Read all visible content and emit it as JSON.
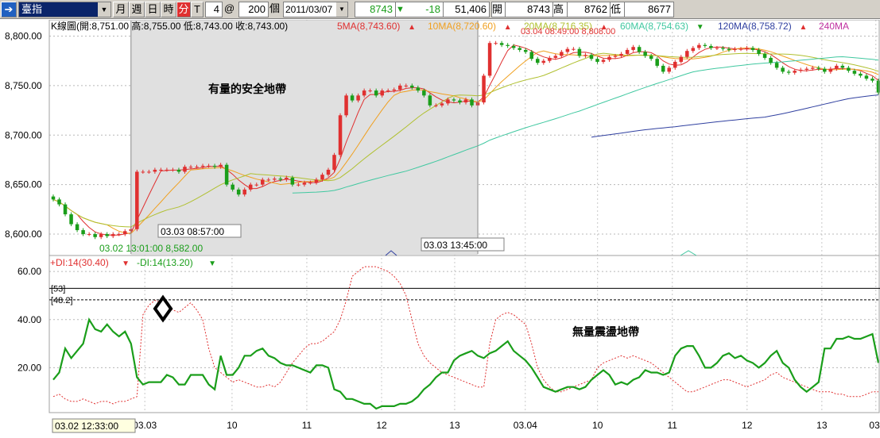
{
  "toolbar": {
    "symbol": "臺指",
    "periods": [
      "月",
      "週",
      "日",
      "時",
      "分",
      "T"
    ],
    "active_period": "分",
    "interval": "4",
    "at": "@",
    "count": "200",
    "count_unit": "個",
    "date": "2011/03/07",
    "quote": {
      "last": "8743",
      "change": "-18",
      "volume": "51,406",
      "open_label": "開",
      "open": "8743",
      "high_label": "高",
      "high": "8762",
      "low_label": "低",
      "low": "8677"
    }
  },
  "colors": {
    "up": "#e03030",
    "down": "#1a9e1a",
    "ma5": "#e03030",
    "ma10": "#f0a020",
    "ma20": "#b0c030",
    "ma60": "#40c8a0",
    "ma120": "#3040a0",
    "ma240": "#c030a0",
    "plus_di": "#e03030",
    "minus_di": "#1a9e1a",
    "highlight": "#e0e0e0"
  },
  "chart_data": [
    {
      "type": "candlestick",
      "title": "K線圖(開:8,751.00 高:8,755.00 低:8,743.00 收:8,743.00)",
      "ma_legend": [
        {
          "name": "5MA",
          "value": "(8,743.60)",
          "dir": "up"
        },
        {
          "name": "10MA",
          "value": "(8,720.60)",
          "dir": "up"
        },
        {
          "name": "20MA",
          "value": "(8,716.35)",
          "dir": "up"
        },
        {
          "name": "60MA",
          "value": "(8,754.63)",
          "dir": "down"
        },
        {
          "name": "120MA",
          "value": "(8,758.72)",
          "dir": "up"
        },
        {
          "name": "240MA",
          "value": "",
          "dir": ""
        }
      ],
      "ylim": [
        8580,
        8810
      ],
      "y_ticks": [
        "8,600.00",
        "8,650.00",
        "8,700.00",
        "8,750.00",
        "8,800.00"
      ],
      "closes": [
        8635,
        8630,
        8620,
        8610,
        8604,
        8600,
        8600,
        8597,
        8600,
        8598,
        8600,
        8600,
        8603,
        8605,
        8663,
        8663,
        8663,
        8665,
        8665,
        8665,
        8665,
        8663,
        8668,
        8668,
        8668,
        8669,
        8669,
        8668,
        8670,
        8650,
        8645,
        8640,
        8645,
        8650,
        8650,
        8655,
        8655,
        8656,
        8655,
        8657,
        8650,
        8650,
        8652,
        8652,
        8655,
        8660,
        8665,
        8680,
        8720,
        8740,
        8735,
        8740,
        8745,
        8745,
        8740,
        8745,
        8745,
        8746,
        8750,
        8750,
        8748,
        8745,
        8740,
        8730,
        8730,
        8732,
        8736,
        8735,
        8733,
        8736,
        8730,
        8733,
        8760,
        8793,
        8793,
        8791,
        8790,
        8788,
        8786,
        8784,
        8777,
        8773,
        8775,
        8778,
        8780,
        8784,
        8787,
        8787,
        8780,
        8781,
        8777,
        8774,
        8776,
        8779,
        8780,
        8782,
        8786,
        8789,
        8784,
        8780,
        8777,
        8770,
        8764,
        8768,
        8774,
        8779,
        8785,
        8788,
        8791,
        8790,
        8788,
        8788,
        8787,
        8786,
        8787,
        8787,
        8788,
        8786,
        8782,
        8778,
        8773,
        8768,
        8764,
        8763,
        8765,
        8766,
        8767,
        8768,
        8767,
        8764,
        8767,
        8770,
        8768,
        8765,
        8762,
        8760,
        8757,
        8755,
        8743
      ],
      "annotations": [
        "有量的安全地帶",
        "03.03 08:57:00",
        "03.03 13:45:00",
        "03.02 13:01:00  8,582.00",
        "03.04 08:49:00  8,808.00"
      ],
      "highlight_range": [
        "03.03 08:57:00",
        "03.03 13:45:00"
      ]
    },
    {
      "type": "line",
      "title": "DMI",
      "series": [
        {
          "name": "+DI:14",
          "value_label": "(30.40)",
          "dir": "down",
          "values": [
            8,
            9,
            7,
            6,
            6,
            7,
            6,
            5,
            6,
            6,
            5,
            6,
            6,
            7,
            8,
            42,
            46,
            48,
            47,
            45,
            44,
            43,
            45,
            47,
            44,
            40,
            28,
            20,
            18,
            16,
            14,
            15,
            14,
            13,
            12,
            12,
            13,
            12,
            14,
            18,
            22,
            25,
            28,
            30,
            30,
            31,
            33,
            35,
            40,
            48,
            58,
            60,
            62,
            62,
            62,
            61,
            60,
            58,
            55,
            50,
            40,
            30,
            25,
            22,
            20,
            18,
            17,
            16,
            15,
            14,
            13,
            12,
            12,
            30,
            40,
            42,
            43,
            42,
            40,
            38,
            30,
            20,
            15,
            12,
            10,
            10,
            11,
            12,
            13,
            14,
            15,
            20,
            22,
            23,
            24,
            25,
            24,
            25,
            24,
            23,
            22,
            20,
            18,
            16,
            14,
            12,
            10,
            10,
            11,
            12,
            13,
            14,
            15,
            15,
            14,
            13,
            12,
            13,
            14,
            15,
            17,
            18,
            16,
            15,
            14,
            13,
            12,
            11,
            10,
            10,
            10,
            9,
            9,
            8,
            8,
            8,
            9,
            10,
            10
          ]
        },
        {
          "name": "-DI:14",
          "value_label": "(13.20)",
          "dir": "down",
          "values": [
            15,
            18,
            28,
            24,
            27,
            30,
            40,
            36,
            35,
            38,
            35,
            33,
            35,
            30,
            16,
            13,
            14,
            14,
            14,
            17,
            16,
            13,
            13,
            17,
            17,
            17,
            13,
            11,
            25,
            17,
            17,
            20,
            25,
            25,
            27,
            28,
            25,
            24,
            22,
            21,
            21,
            20,
            19,
            18,
            21,
            21,
            20,
            11,
            10,
            7,
            7,
            6,
            5,
            5,
            3,
            4,
            4,
            4,
            5,
            5,
            6,
            8,
            11,
            13,
            16,
            18,
            18,
            23,
            25,
            26,
            27,
            25,
            24,
            26,
            27,
            29,
            31,
            27,
            25,
            23,
            20,
            16,
            12,
            11,
            10,
            11,
            12,
            12,
            11,
            12,
            15,
            17,
            19,
            17,
            13,
            14,
            13,
            15,
            16,
            19,
            18,
            18,
            17,
            18,
            25,
            28,
            29,
            29,
            25,
            20,
            20,
            22,
            25,
            26,
            24,
            25,
            23,
            22,
            20,
            22,
            25,
            27,
            22,
            20,
            15,
            12,
            10,
            12,
            14,
            28,
            28,
            32,
            32,
            33,
            32,
            32,
            33,
            34,
            22
          ]
        }
      ],
      "ylim": [
        2,
        64
      ],
      "y_ticks": [
        "20.00",
        "40.00",
        "60.00"
      ],
      "reference_lines": [
        "[53]",
        "[48.2]"
      ],
      "annotations": [
        "無量震盪地帶"
      ]
    }
  ],
  "x_axis": {
    "labels": [
      "03.03",
      "10",
      "11",
      "12",
      "13",
      "03.04",
      "10",
      "11",
      "12",
      "13",
      "03."
    ],
    "crosshair_time": "03.02 12:33:00"
  }
}
